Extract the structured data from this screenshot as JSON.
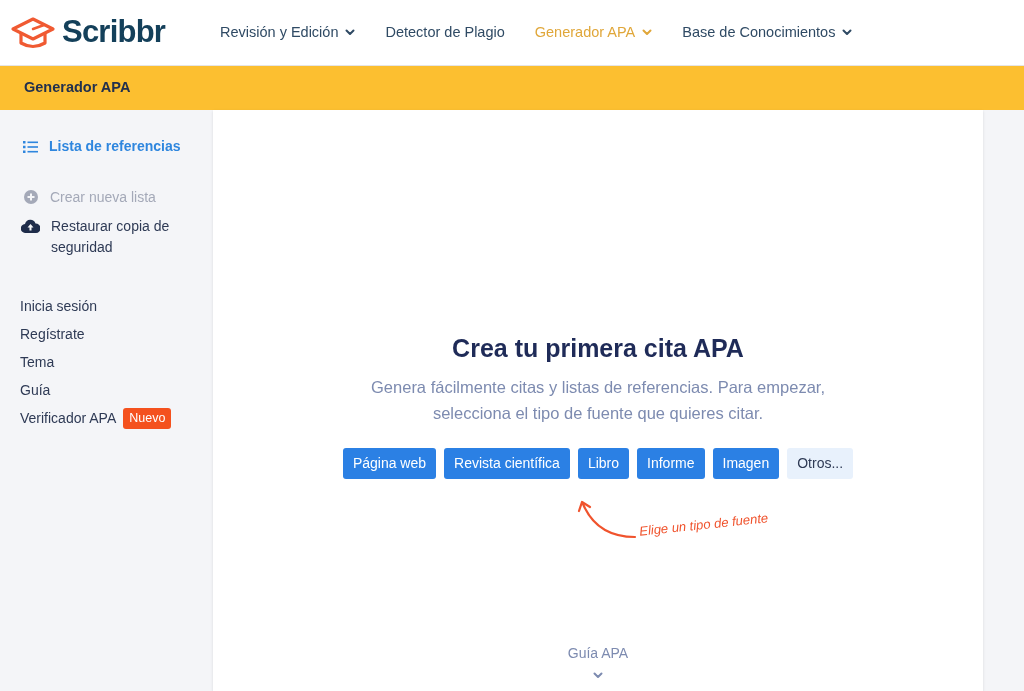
{
  "logo": {
    "text": "Scribbr"
  },
  "nav": [
    {
      "label": "Revisión y Edición",
      "selected": false,
      "dropdown": true
    },
    {
      "label": "Detector de Plagio",
      "selected": false,
      "dropdown": false
    },
    {
      "label": "Generador APA",
      "selected": true,
      "dropdown": true
    },
    {
      "label": "Base de Conocimientos",
      "selected": false,
      "dropdown": true
    }
  ],
  "banner": {
    "title": "Generador APA"
  },
  "sidebar": {
    "active": {
      "label": "Lista de referencias",
      "selected": true
    },
    "actions": [
      {
        "label": "Crear nueva lista",
        "kind": "plus",
        "disabled": true
      },
      {
        "label": "Restaurar copia de seguridad",
        "kind": "cloud",
        "disabled": false
      }
    ],
    "links": [
      {
        "label": "Inicia sesión"
      },
      {
        "label": "Regístrate"
      },
      {
        "label": "Tema"
      },
      {
        "label": "Guía"
      },
      {
        "label": "Verificador APA",
        "badge": "Nuevo"
      }
    ]
  },
  "main": {
    "heading": "Crea tu primera cita APA",
    "subtitle": "Genera fácilmente citas y listas de referencias. Para empezar, selecciona el tipo de fuente que quieres citar.",
    "source_buttons": [
      {
        "label": "Página web",
        "kind": "primary"
      },
      {
        "label": "Revista científica",
        "kind": "primary"
      },
      {
        "label": "Libro",
        "kind": "primary"
      },
      {
        "label": "Informe",
        "kind": "primary"
      },
      {
        "label": "Imagen",
        "kind": "primary"
      },
      {
        "label": "Otros...",
        "kind": "secondary"
      }
    ],
    "hint": "Elige un tipo de fuente",
    "guide_link": "Guía APA"
  }
}
